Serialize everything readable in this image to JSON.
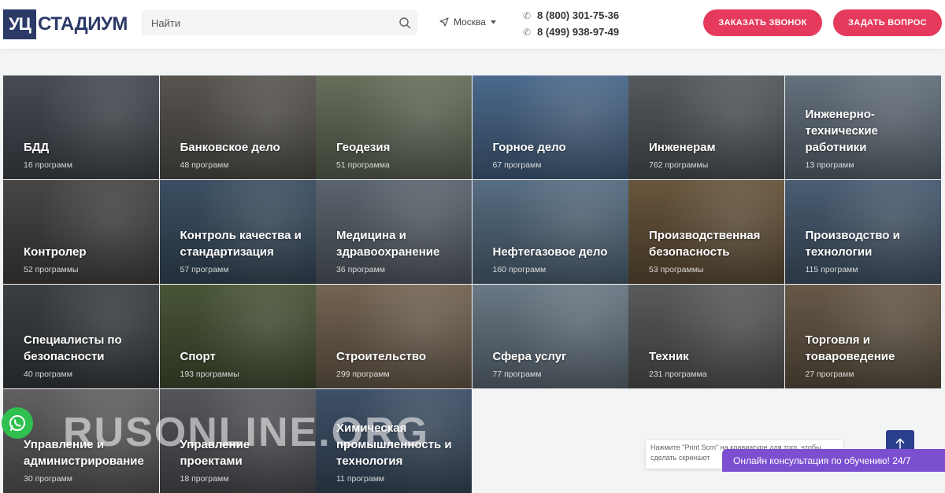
{
  "header": {
    "logo_mark": "УЦ",
    "logo_text": "СТАДИУМ",
    "search_placeholder": "Найти",
    "city": "Москва",
    "phones": [
      "8 (800) 301-75-36",
      "8 (499) 938-97-49"
    ],
    "btn_call": "ЗАКАЗАТЬ ЗВОНОК",
    "btn_ask": "ЗАДАТЬ ВОПРОС"
  },
  "tiles": [
    {
      "title": "БДД",
      "count": "16 программ",
      "color": "#4a4f57"
    },
    {
      "title": "Банковское дело",
      "count": "48 программ",
      "color": "#5d5a55"
    },
    {
      "title": "Геодезия",
      "count": "51 программа",
      "color": "#6b7560"
    },
    {
      "title": "Горное дело",
      "count": "67 программ",
      "color": "#4f6f94"
    },
    {
      "title": "Инженерам",
      "count": "762 программы",
      "color": "#5a5f63"
    },
    {
      "title": "Инженерно-технические работники",
      "count": "13 программ",
      "color": "#6a7784"
    },
    {
      "title": "Контролер",
      "count": "52 программы",
      "color": "#4c4a48"
    },
    {
      "title": "Контроль качества и стандартизация",
      "count": "57 программ",
      "color": "#3f5468"
    },
    {
      "title": "Медицина и здравоохранение",
      "count": "36 программ",
      "color": "#606a74"
    },
    {
      "title": "Нефтегазовое дело",
      "count": "160 программ",
      "color": "#5b7389"
    },
    {
      "title": "Производственная безопасность",
      "count": "53 программы",
      "color": "#6e5a3f"
    },
    {
      "title": "Производство и технологии",
      "count": "115 программ",
      "color": "#4e6279"
    },
    {
      "title": "Специалисты по безопасности",
      "count": "40 программ",
      "color": "#3e4347"
    },
    {
      "title": "Спорт",
      "count": "193 программы",
      "color": "#4d5a3a"
    },
    {
      "title": "Строительство",
      "count": "299 программ",
      "color": "#7a6a57"
    },
    {
      "title": "Сфера услуг",
      "count": "77 программ",
      "color": "#6f7f8c"
    },
    {
      "title": "Техник",
      "count": "231 программа",
      "color": "#5e5f60"
    },
    {
      "title": "Торговля и товароведение",
      "count": "27 программ",
      "color": "#6d5e4c"
    },
    {
      "title": "Управление и администрирование",
      "count": "30 программ",
      "color": "#676566"
    },
    {
      "title": "Управление проектами",
      "count": "18 программ",
      "color": "#5a5b60"
    },
    {
      "title": "Химическая промышленность и технология",
      "count": "11 программ",
      "color": "#42556d"
    }
  ],
  "watermark": "RUSONLINE.ORG",
  "hint": "Нажмите \"Print Scrn\" на клавиатуре для того, чтобы сделать скриншот",
  "consult": "Онлайн консультация по обучению! 24/7",
  "colors": {
    "accent": "#e63a5c",
    "brand": "#2b3a67",
    "consult": "#7c4fd1"
  }
}
